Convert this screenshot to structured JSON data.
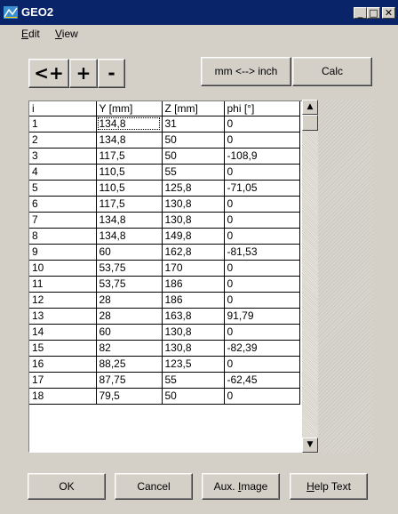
{
  "window": {
    "title": "GEO2"
  },
  "menu": [
    {
      "label": "Edit",
      "underline": "E"
    },
    {
      "label": "View",
      "underline": "V"
    }
  ],
  "toolbar": {
    "insert_before_label": "<+",
    "add_label": "+",
    "remove_label": "-",
    "units_label": "mm <--> inch",
    "calc_label": "Calc"
  },
  "table": {
    "columns": [
      "i",
      "Y [mm]",
      "Z [mm]",
      "phi [°]"
    ],
    "rows": [
      [
        "1",
        "134,8",
        "31",
        "0"
      ],
      [
        "2",
        "134,8",
        "50",
        "0"
      ],
      [
        "3",
        "117,5",
        "50",
        "-108,9"
      ],
      [
        "4",
        "110,5",
        "55",
        "0"
      ],
      [
        "5",
        "110,5",
        "125,8",
        "-71,05"
      ],
      [
        "6",
        "117,5",
        "130,8",
        "0"
      ],
      [
        "7",
        "134,8",
        "130,8",
        "0"
      ],
      [
        "8",
        "134,8",
        "149,8",
        "0"
      ],
      [
        "9",
        "60",
        "162,8",
        "-81,53"
      ],
      [
        "10",
        "53,75",
        "170",
        "0"
      ],
      [
        "11",
        "53,75",
        "186",
        "0"
      ],
      [
        "12",
        "28",
        "186",
        "0"
      ],
      [
        "13",
        "28",
        "163,8",
        "91,79"
      ],
      [
        "14",
        "60",
        "130,8",
        "0"
      ],
      [
        "15",
        "82",
        "130,8",
        "-82,39"
      ],
      [
        "16",
        "88,25",
        "123,5",
        "0"
      ],
      [
        "17",
        "87,75",
        "55",
        "-62,45"
      ],
      [
        "18",
        "79,5",
        "50",
        "0"
      ]
    ]
  },
  "footer": {
    "ok_label": "OK",
    "cancel_label": "Cancel",
    "aux_label": "Aux. Image",
    "help_label": "Help Text"
  },
  "titlebar_buttons": {
    "minimize": "_",
    "maximize": "□",
    "close": "✕"
  }
}
